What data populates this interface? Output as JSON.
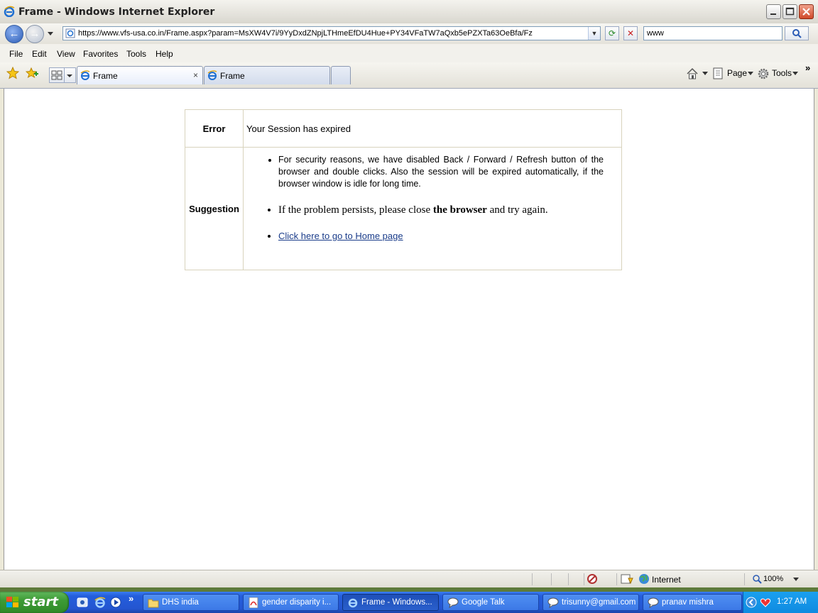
{
  "window": {
    "title": "Frame - Windows Internet Explorer"
  },
  "toolbar": {
    "url": "https://www.vfs-usa.co.in/Frame.aspx?param=MsXW4V7i/9YyDxdZNpjLTHmeEfDU4Hue+PY34VFaTW7aQxb5ePZXTa63OeBfa/Fz",
    "search_value": "www",
    "refresh_glyph": "⟳",
    "stop_glyph": "✕"
  },
  "menu": {
    "items": [
      "File",
      "Edit",
      "View",
      "Favorites",
      "Tools",
      "Help"
    ]
  },
  "tabs": {
    "items": [
      {
        "label": "Frame",
        "active": true
      },
      {
        "label": "Frame",
        "active": false
      }
    ],
    "close_glyph": "×",
    "commands": {
      "page": "Page",
      "tools": "Tools",
      "more": "»"
    }
  },
  "page": {
    "error_label": "Error",
    "error_message": "Your Session has expired",
    "suggestion_label": "Suggestion",
    "suggestion_1": "For security reasons, we have disabled Back / Forward / Refresh button of the browser and double clicks.  Also the session will be expired automatically, if the browser window is idle for long time.",
    "suggestion_2_pre": "If the problem persists, please close ",
    "suggestion_2_bold": "the browser",
    "suggestion_2_post": " and try again.",
    "home_link": "Click here to go to Home page"
  },
  "statusbar": {
    "zone": "Internet",
    "zoom": "100%"
  },
  "taskbar": {
    "start_label": "start",
    "tasks": [
      {
        "label": "DHS india",
        "icon": "folder-icon"
      },
      {
        "label": "gender disparity i...",
        "icon": "pdf-icon"
      },
      {
        "label": "Frame - Windows...",
        "icon": "ie-icon"
      },
      {
        "label": "Google Talk",
        "icon": "chat-icon"
      },
      {
        "label": "trisunny@gmail.com",
        "icon": "chat-icon"
      },
      {
        "label": "pranav mishra",
        "icon": "chat-icon"
      }
    ],
    "more_glyph": "»",
    "clock": "1:27 AM"
  },
  "colors": {
    "link": "#1a3c8a",
    "table_border": "#d8d3bd",
    "taskbar": "#245edc",
    "start": "#3d9b35"
  }
}
